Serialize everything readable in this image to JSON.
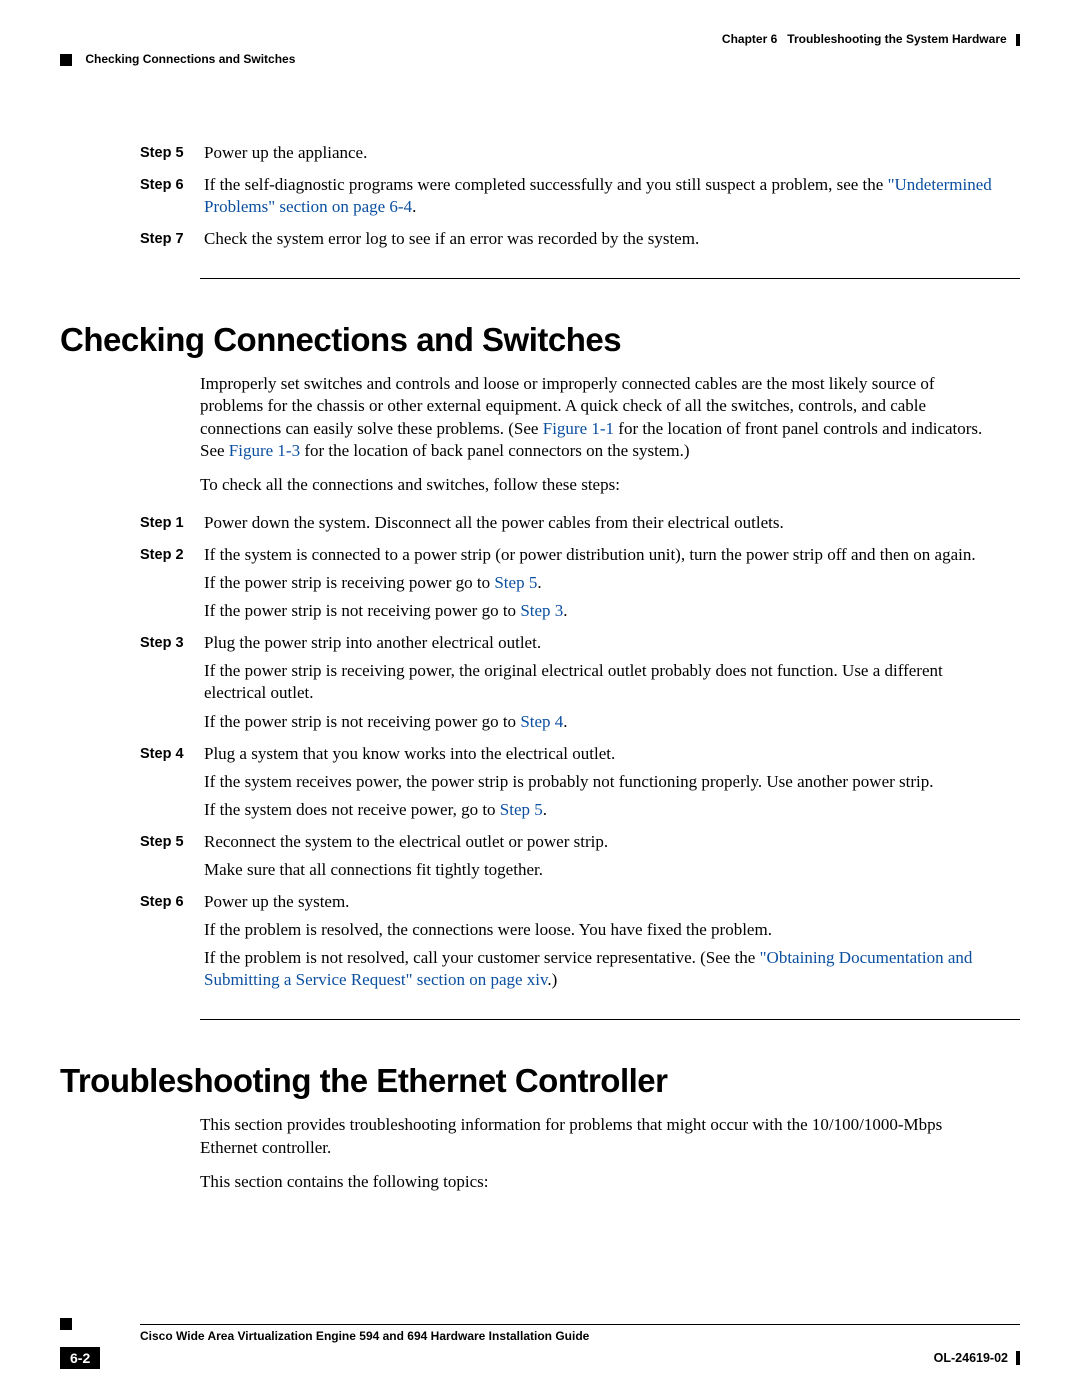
{
  "header": {
    "chapter_label": "Chapter 6",
    "chapter_title": "Troubleshooting the System Hardware",
    "section_breadcrumb": "Checking Connections and Switches"
  },
  "steps_top": [
    {
      "label": "Step 5",
      "paragraphs": [
        {
          "runs": [
            {
              "t": "Power up the appliance."
            }
          ]
        }
      ]
    },
    {
      "label": "Step 6",
      "paragraphs": [
        {
          "runs": [
            {
              "t": "If the self-diagnostic programs were completed successfully and you still suspect a problem, see the "
            },
            {
              "t": "\"Undetermined Problems\" section on page 6-4",
              "link": true
            },
            {
              "t": "."
            }
          ]
        }
      ]
    },
    {
      "label": "Step 7",
      "paragraphs": [
        {
          "runs": [
            {
              "t": "Check the system error log to see if an error was recorded by the system."
            }
          ]
        }
      ]
    }
  ],
  "section1": {
    "heading": "Checking Connections and Switches",
    "intro": [
      {
        "runs": [
          {
            "t": "Improperly set switches and controls and loose or improperly connected cables are the most likely source of problems for the chassis or other external equipment. A quick check of all the switches, controls, and cable connections can easily solve these problems. (See "
          },
          {
            "t": "Figure 1-1",
            "link": true
          },
          {
            "t": " for the location of front panel controls and indicators. See "
          },
          {
            "t": "Figure 1-3",
            "link": true
          },
          {
            "t": " for the location of back panel connectors on the system.)"
          }
        ]
      },
      {
        "runs": [
          {
            "t": "To check all the connections and switches, follow these steps:"
          }
        ]
      }
    ],
    "steps": [
      {
        "label": "Step 1",
        "paragraphs": [
          {
            "runs": [
              {
                "t": "Power down the system. Disconnect all the power cables from their electrical outlets."
              }
            ]
          }
        ]
      },
      {
        "label": "Step 2",
        "paragraphs": [
          {
            "runs": [
              {
                "t": "If the system is connected to a power strip (or power distribution unit), turn the power strip off and then on again."
              }
            ]
          },
          {
            "runs": [
              {
                "t": "If the power strip is receiving power go to "
              },
              {
                "t": "Step 5",
                "link": true
              },
              {
                "t": "."
              }
            ]
          },
          {
            "runs": [
              {
                "t": "If the power strip is not receiving power go to "
              },
              {
                "t": "Step 3",
                "link": true
              },
              {
                "t": "."
              }
            ]
          }
        ]
      },
      {
        "label": "Step 3",
        "paragraphs": [
          {
            "runs": [
              {
                "t": "Plug the power strip into another electrical outlet."
              }
            ]
          },
          {
            "runs": [
              {
                "t": "If the power strip is receiving power, the original electrical outlet probably does not function. Use a different electrical outlet."
              }
            ]
          },
          {
            "runs": [
              {
                "t": "If the power strip is not receiving power go to "
              },
              {
                "t": "Step 4",
                "link": true
              },
              {
                "t": "."
              }
            ]
          }
        ]
      },
      {
        "label": "Step 4",
        "paragraphs": [
          {
            "runs": [
              {
                "t": "Plug a system that you know works into the electrical outlet."
              }
            ]
          },
          {
            "runs": [
              {
                "t": "If the system receives power, the power strip is probably not functioning properly. Use another power strip."
              }
            ]
          },
          {
            "runs": [
              {
                "t": "If the system does not receive power, go to "
              },
              {
                "t": "Step 5",
                "link": true
              },
              {
                "t": "."
              }
            ]
          }
        ]
      },
      {
        "label": "Step 5",
        "paragraphs": [
          {
            "runs": [
              {
                "t": "Reconnect the system to the electrical outlet or power strip."
              }
            ]
          },
          {
            "runs": [
              {
                "t": "Make sure that all connections fit tightly together."
              }
            ]
          }
        ]
      },
      {
        "label": "Step 6",
        "paragraphs": [
          {
            "runs": [
              {
                "t": "Power up the system."
              }
            ]
          },
          {
            "runs": [
              {
                "t": "If the problem is resolved, the connections were loose. You have fixed the problem."
              }
            ]
          },
          {
            "runs": [
              {
                "t": "If the problem is not resolved, call your customer service representative. (See the "
              },
              {
                "t": "\"Obtaining Documentation and Submitting a Service Request\" section on page xiv",
                "link": true
              },
              {
                "t": ".)"
              }
            ]
          }
        ]
      }
    ]
  },
  "section2": {
    "heading": "Troubleshooting the Ethernet Controller",
    "intro": [
      {
        "runs": [
          {
            "t": "This section provides troubleshooting information for problems that might occur with the 10/100/1000-Mbps Ethernet controller."
          }
        ]
      },
      {
        "runs": [
          {
            "t": "This section contains the following topics:"
          }
        ]
      }
    ]
  },
  "footer": {
    "guide_title": "Cisco Wide Area Virtualization Engine 594 and 694 Hardware Installation Guide",
    "page_number": "6-2",
    "doc_id": "OL-24619-02"
  }
}
